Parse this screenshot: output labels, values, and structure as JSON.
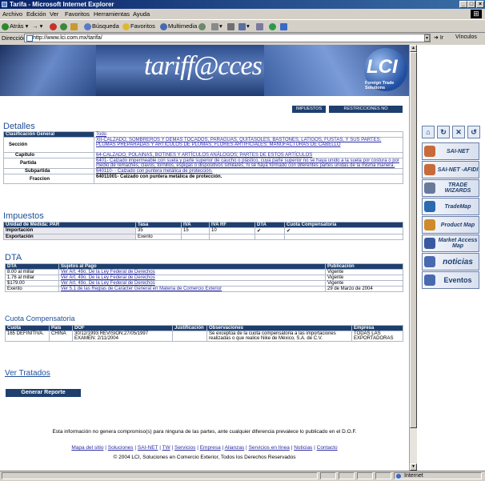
{
  "window": {
    "title": "Tarifa - Microsoft Internet Explorer"
  },
  "menu": [
    "Archivo",
    "Edición",
    "Ver",
    "Favoritos",
    "Herramientas",
    "Ayuda"
  ],
  "toolbar": {
    "back": "Atrás",
    "search": "Búsqueda",
    "favorites": "Favoritos",
    "multimedia": "Multimedia"
  },
  "address": {
    "label": "Dirección",
    "url": "http://www.lci.com.mx/tarifa/",
    "go": "Ir",
    "links": "Vínculos"
  },
  "banner": {
    "title": "tariff@cces",
    "logo": "LCI",
    "logo_sub": "Foreign Trade Solutions"
  },
  "top_buttons": [
    "IMPUESTOS",
    "RESTRICCIONES NO ARANCELARIAS"
  ],
  "detalles": {
    "heading": "Detalles",
    "header_label": "Clasificación General",
    "header_value": "Todo",
    "rows": [
      {
        "label": "Sección",
        "value": "XII-CALZADO, SOMBREROS Y DEMAS TOCADOS, PARAGUAS, QUITASOLES, BASTONES, LATIGOS, FUSTAS, Y SUS PARTES; PLUMAS PREPARADAS Y ARTICULOS DE PLUMAS; FLORES ARTIFICIALES; MANUFACTURAS DE CABELLO"
      },
      {
        "label": "Capítulo",
        "value": "64-CALZADO, POLAINAS, BOTINES Y ARTÍCULOS ANÁLOGOS; PARTES DE ESTOS ARTÍCULOS"
      },
      {
        "label": "Partida",
        "value": "6401- Calzado impermeable con suela y parte superior de caucho o plástico, cuya parte superior no se haya unido a la suela por costura o por medio de remaches, clavos, tornillos, espigas o dispositivos similares, ni se haya formado con diferentes partes unidas de la misma manera."
      },
      {
        "label": "Subpartida",
        "value": "640110- - Calzado con puntera metálica de protección."
      },
      {
        "label": "Fraccion",
        "value": "64011001- Calzado con puntera metálica de protección."
      }
    ]
  },
  "impuestos": {
    "heading": "Impuestos",
    "headers": [
      "Unidad de Medida: PAR",
      "Tasa",
      "IVA",
      "IVA RF",
      "DTA",
      "Cuota Compensatoria"
    ],
    "rows": [
      {
        "label": "Importación",
        "tasa": "35",
        "iva": "15",
        "ivarf": "10",
        "dta": "✔",
        "cuota": "✔"
      },
      {
        "label": "Exportación",
        "tasa": "Exento",
        "iva": "",
        "ivarf": "",
        "dta": "",
        "cuota": ""
      }
    ]
  },
  "dta": {
    "heading": "DTA",
    "headers": [
      "DTA",
      "Sujetos al Pago",
      "Publicación"
    ],
    "rows": [
      {
        "dta": "8.00 al millar",
        "sujetos": "Ver Art. 49o. De la Ley Federal de Derechos",
        "pub": "Vigente"
      },
      {
        "dta": "1.76 al millar",
        "sujetos": "Ver Art. 49o. De la Ley Federal de Derechos",
        "pub": "Vigente"
      },
      {
        "dta": "$179.00",
        "sujetos": "Ver Art. 49o. De la Ley Federal de Derechos",
        "pub": "Vigente"
      },
      {
        "dta": "Exento",
        "sujetos": "Ver 5.1 de las Reglas de Carácter General en Materia de Comercio Exterior",
        "pub": "29 de Marzo de 2004"
      }
    ]
  },
  "cuota": {
    "heading": "Cuota Compensatoria",
    "headers": [
      "Cuota",
      "País",
      "DOF",
      "Justificación",
      "Observaciones",
      "Empresa"
    ],
    "row": {
      "cuota": "165 DEFINITIVA.",
      "pais": "CHINA",
      "dof": "30/12/1993 REVISION:27/05/1997 EXAMEN: 2/11/2004",
      "just": "",
      "obs": "Se exceptúa de la cuota compensatoria a las importaciones realizadas o que realice Nike de México, S.A. de C.V.",
      "empresa": "TODAS LAS EXPORTADORAS"
    }
  },
  "ver_tratados": "Ver Tratados",
  "generar_reporte": "Generar Reporte",
  "disclaimer": "Esta información no genera compromiso(s) para ninguna de las partes, ante cualquier diferencia prevalece lo publicado en el D.O.F.",
  "footer_links": [
    "Mapa del sitio",
    "Soluciones",
    "SAI-NET",
    "TW",
    "Servicios",
    "Empresa",
    "Alianzas",
    "Servicios en línea",
    "Noticias",
    "Contacto"
  ],
  "copyright": "© 2004 LCI, Soluciones en Comercio Exterior, Todos los Derechos Reservados",
  "sidebar": {
    "buttons": [
      "SAI-NET",
      "SAI-NET -AFIDI",
      "TRADE WIZARDS",
      "TradeMap",
      "Product Map",
      "Market Access Map",
      "noticias",
      "Eventos"
    ]
  },
  "status": {
    "zone": "Internet"
  }
}
